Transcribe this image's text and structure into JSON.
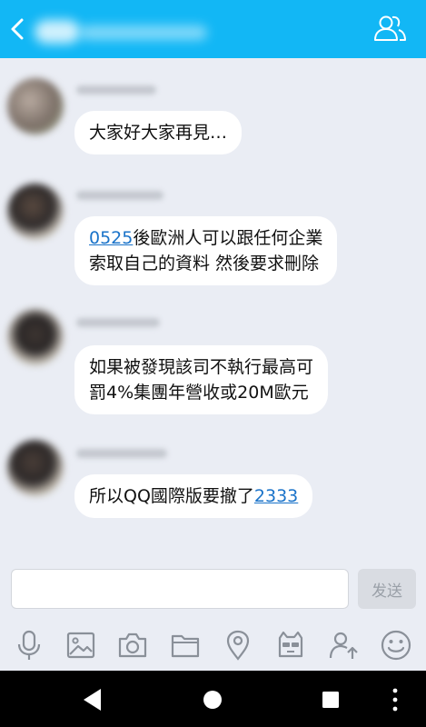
{
  "header": {
    "title_blurred": true
  },
  "messages": [
    {
      "parts": [
        {
          "text": "大家好大家再見…",
          "link": false
        }
      ]
    },
    {
      "parts": [
        {
          "text": "0525",
          "link": true
        },
        {
          "text": "後歐洲人可以跟任何企業",
          "link": false
        }
      ],
      "line2": "索取自己的資料 然後要求刪除"
    },
    {
      "parts": [
        {
          "text": "如果被發現該司不執行最高可",
          "link": false
        }
      ],
      "line2": "罰4%集團年營收或20M歐元"
    },
    {
      "parts": [
        {
          "text": "所以QQ國際版要撤了",
          "link": false
        },
        {
          "text": "2333",
          "link": true
        }
      ]
    }
  ],
  "input": {
    "value": "",
    "placeholder": ""
  },
  "send": {
    "label": "发送"
  },
  "toolbar": {
    "icons": [
      "microphone-icon",
      "image-icon",
      "camera-icon",
      "folder-icon",
      "location-icon",
      "sticker-icon",
      "contact-share-icon",
      "emoji-icon"
    ]
  },
  "colors": {
    "header": "#12b7f5",
    "background": "#eaedf4",
    "bubble": "#ffffff",
    "link": "#1a73c9",
    "icon": "#8a9099"
  }
}
